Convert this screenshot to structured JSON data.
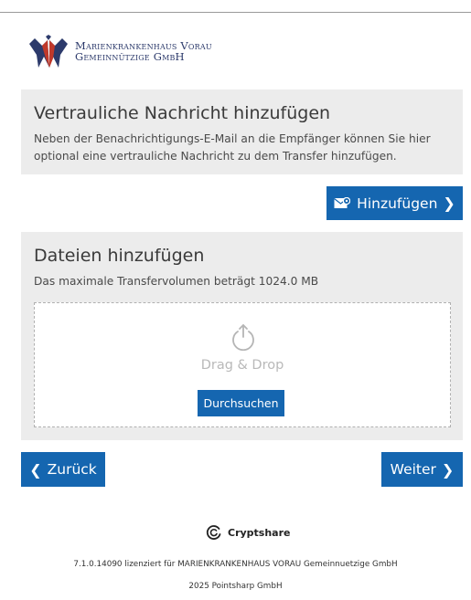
{
  "header": {
    "logo_line1": "Marienkrankenhaus Vorau",
    "logo_line2": "Gemeinnützige GmbH"
  },
  "message_section": {
    "title": "Vertrauliche Nachricht hinzufügen",
    "description": "Neben der Benachrichtigungs-E-Mail an die Empfänger können Sie hier optional eine vertrauliche Nachricht zu dem Transfer hinzufügen.",
    "add_button_label": "Hinzufügen"
  },
  "files_section": {
    "title": "Dateien hinzufügen",
    "limit_text": "Das maximale Transfervolumen beträgt 1024.0 MB",
    "dropzone_label": "Drag & Drop",
    "browse_button_label": "Durchsuchen"
  },
  "navigation": {
    "back_label": "Zurück",
    "next_label": "Weiter"
  },
  "footer": {
    "brand_name": "Cryptshare",
    "license_text": "7.1.0.14090 lizenziert für MARIENKRANKENHAUS VORAU Gemeinnuetzige GmbH",
    "copyright_text": "2025 Pointsharp GmbH"
  },
  "colors": {
    "primary_button": "#1566b0",
    "panel_background": "#ececec",
    "logo_text": "#2c3a6b"
  },
  "icons": {
    "logo": "bird-wings-logo-icon",
    "add_message": "envelope-icon",
    "upload": "upload-icon",
    "brand": "cryptshare-logo-icon"
  }
}
